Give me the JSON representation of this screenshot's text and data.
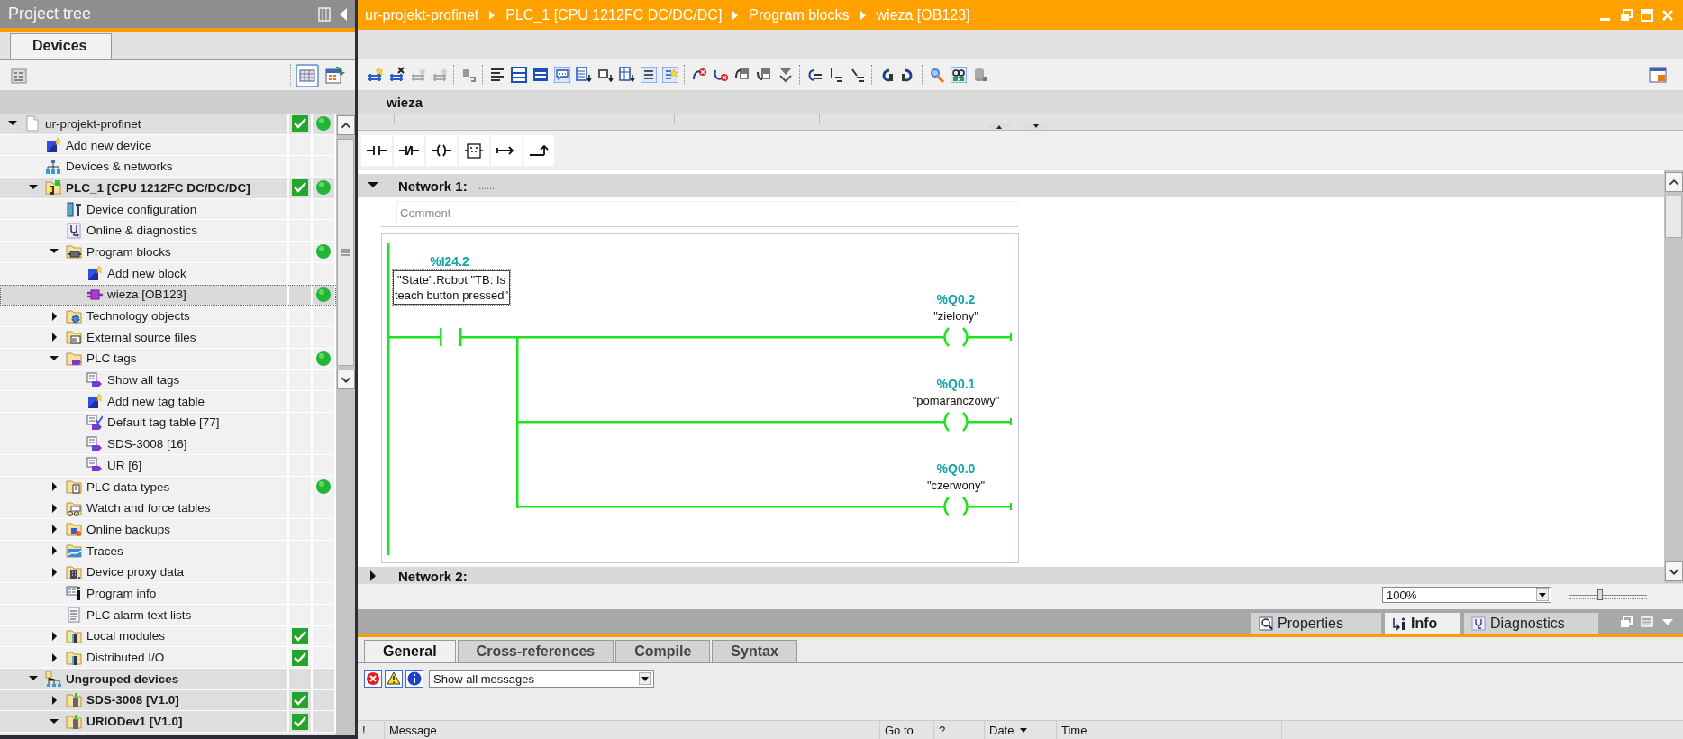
{
  "project_tree": {
    "title": "Project tree",
    "tabs": [
      {
        "label": "Devices",
        "selected": true
      }
    ],
    "items": [
      {
        "label": "ur-projekt-profinet",
        "kind": "project",
        "expanded": true,
        "selected": false,
        "check": true,
        "online": true,
        "children": [
          {
            "label": "Add new device",
            "kind": "add_action",
            "selected": false,
            "check": false,
            "online": false
          },
          {
            "label": "Devices & networks",
            "kind": "network_view",
            "selected": false,
            "check": false,
            "online": false
          },
          {
            "label": "PLC_1 [CPU 1212FC DC/DC/DC]",
            "kind": "plc",
            "expanded": true,
            "selected": false,
            "check": true,
            "online": true,
            "children": [
              {
                "label": "Device configuration",
                "kind": "device_config",
                "selected": false,
                "check": false,
                "online": false
              },
              {
                "label": "Online & diagnostics",
                "kind": "diagnostics",
                "selected": false,
                "check": false,
                "online": false
              },
              {
                "label": "Program blocks",
                "kind": "block_folder",
                "expanded": true,
                "selected": false,
                "check": false,
                "online": true,
                "children": [
                  {
                    "label": "Add new block",
                    "kind": "add_action",
                    "selected": false,
                    "check": false,
                    "online": false
                  },
                  {
                    "label": "wieza [OB123]",
                    "kind": "block",
                    "selected": true,
                    "check": false,
                    "online": true
                  }
                ]
              },
              {
                "label": "Technology objects",
                "kind": "tech_folder",
                "expanded": false,
                "selected": false,
                "check": false,
                "online": false
              },
              {
                "label": "External source files",
                "kind": "source_folder",
                "expanded": false,
                "selected": false,
                "check": false,
                "online": false
              },
              {
                "label": "PLC tags",
                "kind": "tag_folder",
                "expanded": true,
                "selected": false,
                "check": false,
                "online": true,
                "children": [
                  {
                    "label": "Show all tags",
                    "kind": "tags_view",
                    "selected": false,
                    "check": false,
                    "online": false
                  },
                  {
                    "label": "Add new tag table",
                    "kind": "add_action",
                    "selected": false,
                    "check": false,
                    "online": false
                  },
                  {
                    "label": "Default tag table [77]",
                    "kind": "default_table",
                    "selected": false,
                    "check": false,
                    "online": false
                  },
                  {
                    "label": "SDS-3008 [16]",
                    "kind": "tag_table",
                    "selected": false,
                    "check": false,
                    "online": false
                  },
                  {
                    "label": "UR [6]",
                    "kind": "tag_table",
                    "selected": false,
                    "check": false,
                    "online": false
                  }
                ]
              },
              {
                "label": "PLC data types",
                "kind": "types_folder",
                "expanded": false,
                "selected": false,
                "check": false,
                "online": true
              },
              {
                "label": "Watch and force tables",
                "kind": "watch_folder",
                "expanded": false,
                "selected": false,
                "check": false,
                "online": false
              },
              {
                "label": "Online backups",
                "kind": "backup_folder",
                "expanded": false,
                "selected": false,
                "check": false,
                "online": false
              },
              {
                "label": "Traces",
                "kind": "trace_folder",
                "expanded": false,
                "selected": false,
                "check": false,
                "online": false
              },
              {
                "label": "Device proxy data",
                "kind": "proxy_folder",
                "expanded": false,
                "selected": false,
                "check": false,
                "online": false
              },
              {
                "label": "Program info",
                "kind": "program_info",
                "selected": false,
                "check": false,
                "online": false
              },
              {
                "label": "PLC alarm text lists",
                "kind": "alarm_list",
                "selected": false,
                "check": false,
                "online": false
              },
              {
                "label": "Local modules",
                "kind": "modules_folder",
                "expanded": false,
                "selected": false,
                "check": true,
                "online": false
              },
              {
                "label": "Distributed I/O",
                "kind": "modules_folder",
                "expanded": false,
                "selected": false,
                "check": true,
                "online": false
              }
            ]
          },
          {
            "label": "Ungrouped devices",
            "kind": "station_group",
            "expanded": true,
            "selected": false,
            "check": false,
            "online": false,
            "children": [
              {
                "label": "SDS-3008 [V1.0]",
                "kind": "station",
                "expanded": false,
                "selected": false,
                "check": true,
                "online": false
              },
              {
                "label": "URIODev1 [V1.0]",
                "kind": "station",
                "expanded": true,
                "selected": false,
                "check": true,
                "online": false
              }
            ]
          }
        ]
      }
    ]
  },
  "editor": {
    "breadcrumb": [
      "ur-projekt-profinet",
      "PLC_1 [CPU 1212FC DC/DC/DC]",
      "Program blocks",
      "wieza [OB123]"
    ],
    "block_name": "wieza",
    "networks": [
      {
        "title": "Network 1:",
        "title_hint": "......",
        "expanded": true,
        "comment_placeholder": "Comment",
        "contact": {
          "address": "%I24.2",
          "tag": "\"State\".Robot.\"TB: Is teach button pressed\""
        },
        "coils": [
          {
            "address": "%Q0.2",
            "tag": "\"zielony\""
          },
          {
            "address": "%Q0.1",
            "tag": "\"pomarańczowy\""
          },
          {
            "address": "%Q0.0",
            "tag": "\"czerwony\""
          }
        ]
      },
      {
        "title": "Network 2:",
        "expanded": false
      }
    ],
    "zoom": {
      "value": "100%",
      "level": 0.4
    }
  },
  "inspector": {
    "tabs": [
      {
        "label": "Properties",
        "selected": false
      },
      {
        "label": "Info",
        "selected": true
      },
      {
        "label": "Diagnostics",
        "selected": false
      }
    ],
    "subtabs": [
      {
        "label": "General",
        "selected": true
      },
      {
        "label": "Cross-references",
        "selected": false
      },
      {
        "label": "Compile",
        "selected": false
      },
      {
        "label": "Syntax",
        "selected": false
      }
    ],
    "filter": "Show all messages",
    "columns": [
      "!",
      "Message",
      "Go to",
      "?",
      "Date",
      "Time"
    ]
  }
}
